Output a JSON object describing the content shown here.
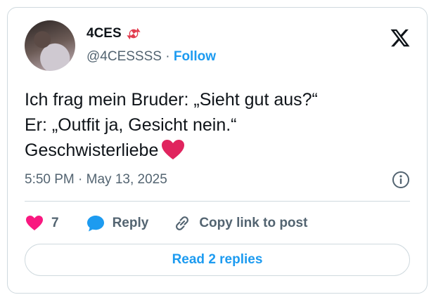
{
  "author": {
    "name": "4CES",
    "handle": "@4CESSSS",
    "separator": "·",
    "follow_label": "Follow"
  },
  "tweet": {
    "lines": [
      "Ich frag mein Bruder: „Sieht gut aus?“",
      "Er: „Outfit ja, Gesicht nein.“",
      "Geschwisterliebe"
    ],
    "emoji": "red-heart",
    "timestamp": "5:50 PM · May 13, 2025"
  },
  "actions": {
    "likes_count": "7",
    "reply_label": "Reply",
    "copy_link_label": "Copy link to post"
  },
  "replies_button": "Read 2 replies",
  "colors": {
    "accent": "#1d9bf0",
    "like": "#f91880",
    "emoji_red": "#e0245e",
    "text_secondary": "#536471",
    "border": "#cfd9de"
  }
}
